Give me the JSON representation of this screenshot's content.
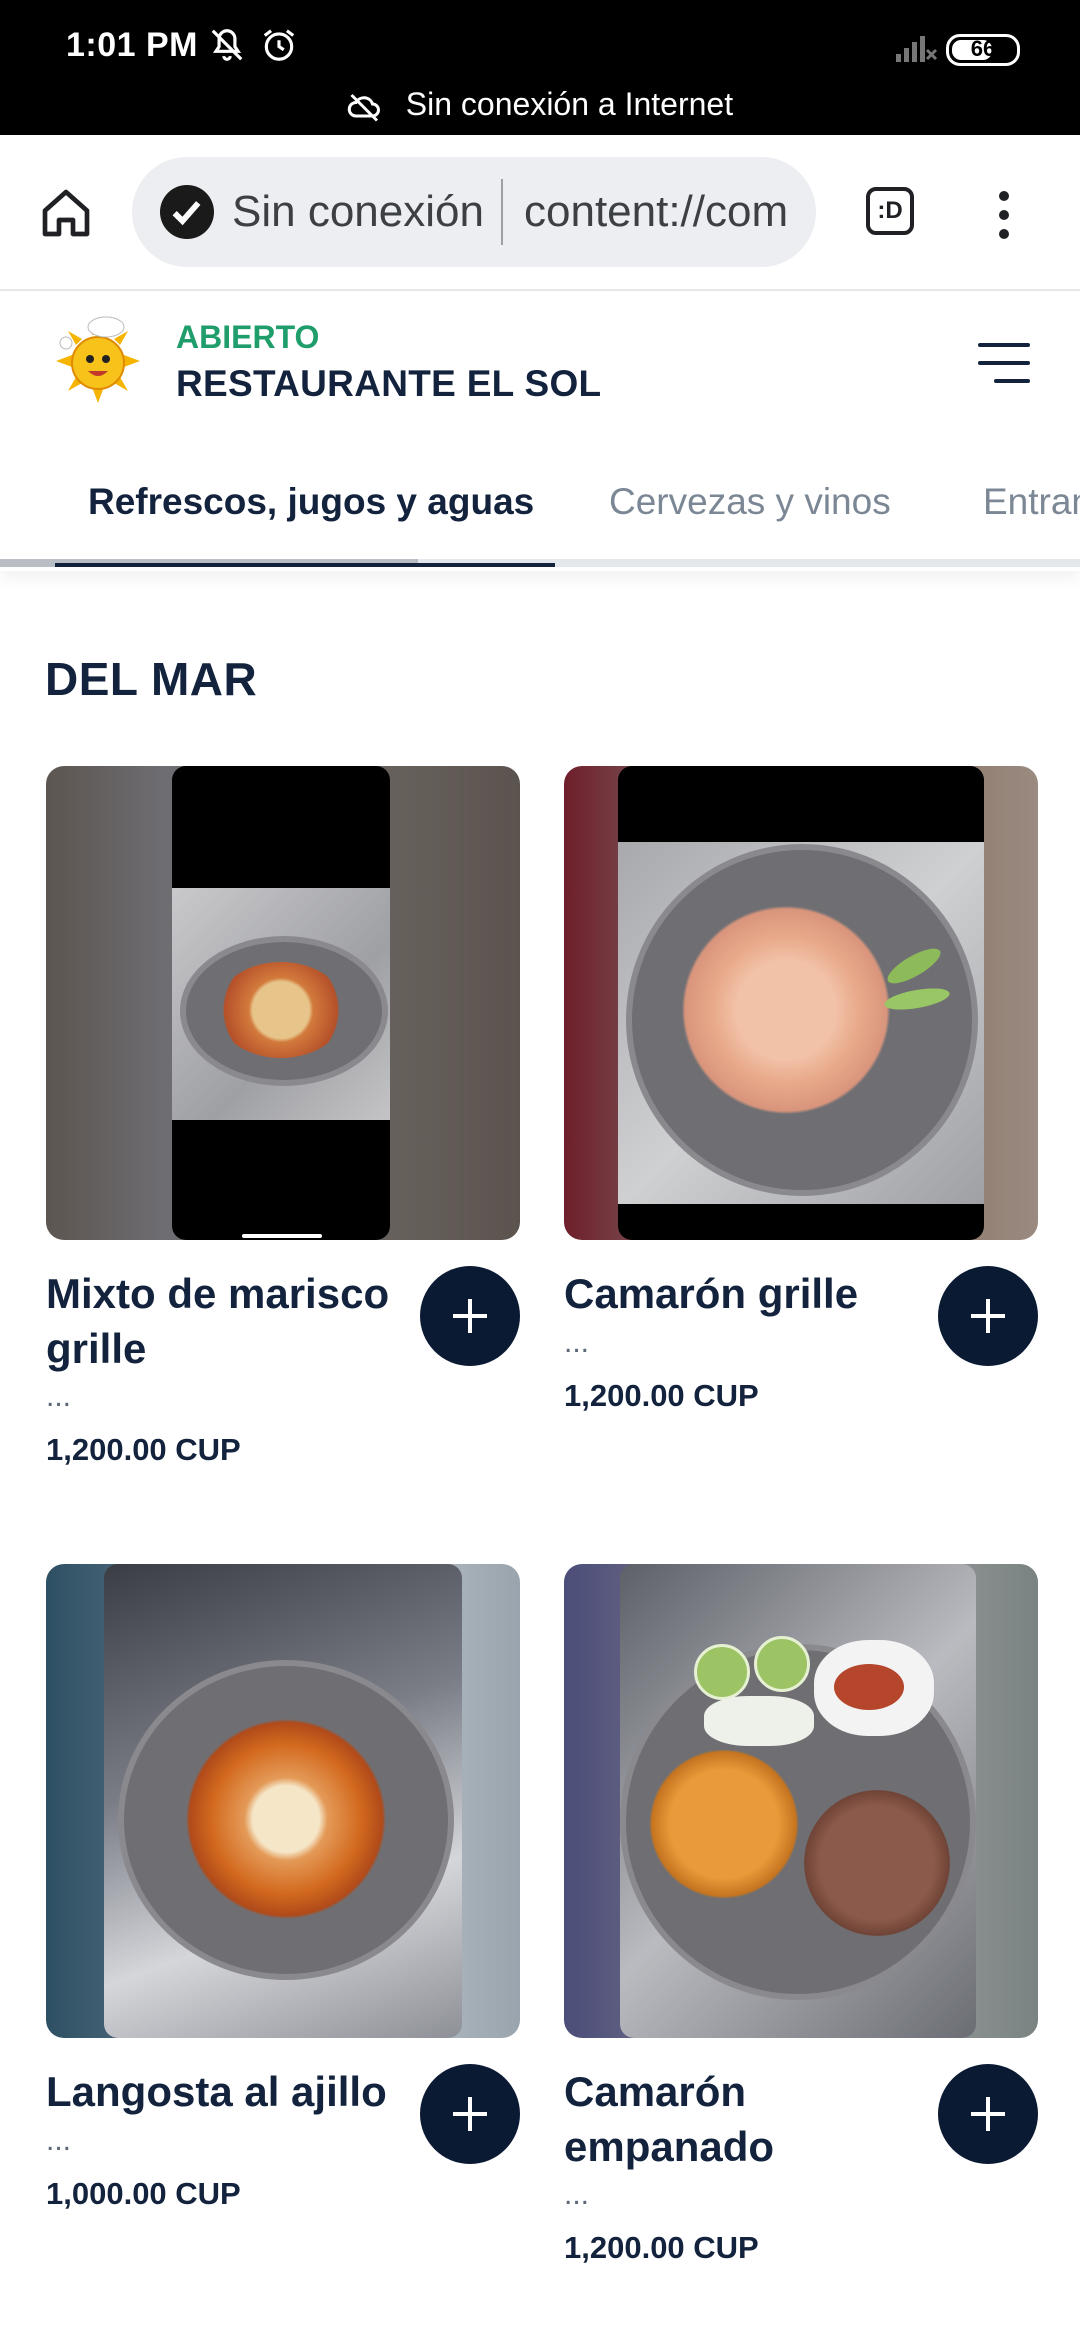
{
  "status_bar": {
    "time": "1:01 PM",
    "battery": "66",
    "offline_banner": "Sin conexión a Internet"
  },
  "browser": {
    "connection_status": "Sin conexión",
    "url": "content://com",
    "tabs_label": ":D"
  },
  "restaurant": {
    "status": "ABIERTO",
    "name": "RESTAURANTE EL SOL"
  },
  "categories": [
    {
      "label": "Refrescos, jugos y aguas",
      "active": true
    },
    {
      "label": "Cervezas y vinos",
      "active": false
    },
    {
      "label": "Entrantes",
      "active": false
    }
  ],
  "section": {
    "title": "DEL MAR"
  },
  "products": [
    {
      "name": "Mixto de marisco grille",
      "description": "...",
      "price": "1,200.00 CUP"
    },
    {
      "name": "Camarón grille",
      "description": "...",
      "price": "1,200.00 CUP"
    },
    {
      "name": "Langosta al ajillo",
      "description": "...",
      "price": "1,000.00 CUP"
    },
    {
      "name": "Camarón empanado",
      "description": "...",
      "price": "1,200.00 CUP"
    }
  ],
  "colors": {
    "open_status": "#1f9d6b",
    "primary_dark": "#0b1a33",
    "text_dark": "#13233d"
  }
}
